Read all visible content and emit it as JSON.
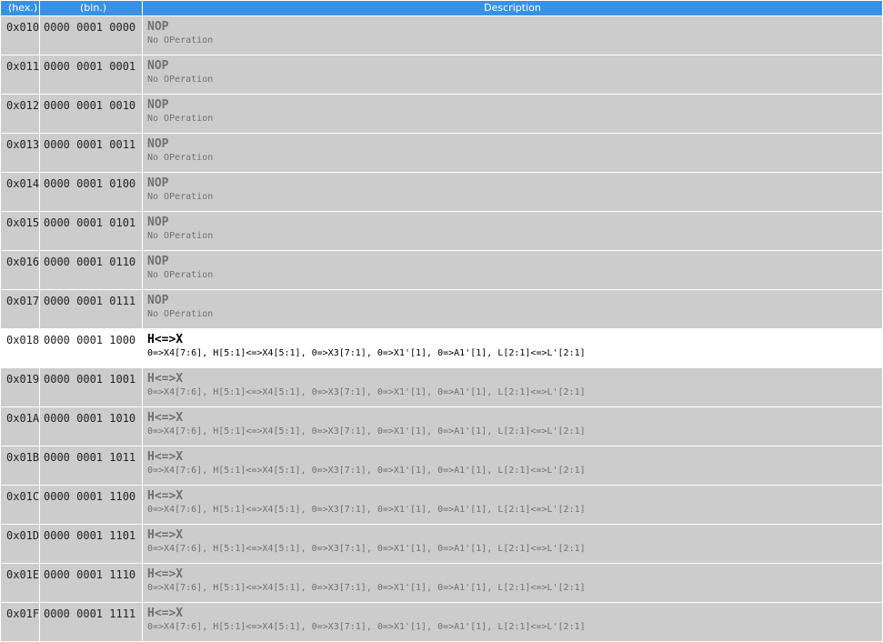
{
  "header": {
    "hex": "(hex.)",
    "bin": "(bin.)",
    "desc": "Description"
  },
  "rows": [
    {
      "hex": "0x010",
      "bin": "0000 0001 0000",
      "mnemonic": "NOP",
      "detail": "No OPeration",
      "active": false
    },
    {
      "hex": "0x011",
      "bin": "0000 0001 0001",
      "mnemonic": "NOP",
      "detail": "No OPeration",
      "active": false
    },
    {
      "hex": "0x012",
      "bin": "0000 0001 0010",
      "mnemonic": "NOP",
      "detail": "No OPeration",
      "active": false
    },
    {
      "hex": "0x013",
      "bin": "0000 0001 0011",
      "mnemonic": "NOP",
      "detail": "No OPeration",
      "active": false
    },
    {
      "hex": "0x014",
      "bin": "0000 0001 0100",
      "mnemonic": "NOP",
      "detail": "No OPeration",
      "active": false
    },
    {
      "hex": "0x015",
      "bin": "0000 0001 0101",
      "mnemonic": "NOP",
      "detail": "No OPeration",
      "active": false
    },
    {
      "hex": "0x016",
      "bin": "0000 0001 0110",
      "mnemonic": "NOP",
      "detail": "No OPeration",
      "active": false
    },
    {
      "hex": "0x017",
      "bin": "0000 0001 0111",
      "mnemonic": "NOP",
      "detail": "No OPeration",
      "active": false
    },
    {
      "hex": "0x018",
      "bin": "0000 0001 1000",
      "mnemonic": "H<=>X",
      "detail": "0=>X4[7:6], H[5:1]<=>X4[5:1], 0=>X3[7:1], 0=>X1'[1], 0=>A1'[1], L[2:1]<=>L'[2:1]",
      "active": true
    },
    {
      "hex": "0x019",
      "bin": "0000 0001 1001",
      "mnemonic": "H<=>X",
      "detail": "0=>X4[7:6], H[5:1]<=>X4[5:1], 0=>X3[7:1], 0=>X1'[1], 0=>A1'[1], L[2:1]<=>L'[2:1]",
      "active": false
    },
    {
      "hex": "0x01A",
      "bin": "0000 0001 1010",
      "mnemonic": "H<=>X",
      "detail": "0=>X4[7:6], H[5:1]<=>X4[5:1], 0=>X3[7:1], 0=>X1'[1], 0=>A1'[1], L[2:1]<=>L'[2:1]",
      "active": false
    },
    {
      "hex": "0x01B",
      "bin": "0000 0001 1011",
      "mnemonic": "H<=>X",
      "detail": "0=>X4[7:6], H[5:1]<=>X4[5:1], 0=>X3[7:1], 0=>X1'[1], 0=>A1'[1], L[2:1]<=>L'[2:1]",
      "active": false
    },
    {
      "hex": "0x01C",
      "bin": "0000 0001 1100",
      "mnemonic": "H<=>X",
      "detail": "0=>X4[7:6], H[5:1]<=>X4[5:1], 0=>X3[7:1], 0=>X1'[1], 0=>A1'[1], L[2:1]<=>L'[2:1]",
      "active": false
    },
    {
      "hex": "0x01D",
      "bin": "0000 0001 1101",
      "mnemonic": "H<=>X",
      "detail": "0=>X4[7:6], H[5:1]<=>X4[5:1], 0=>X3[7:1], 0=>X1'[1], 0=>A1'[1], L[2:1]<=>L'[2:1]",
      "active": false
    },
    {
      "hex": "0x01E",
      "bin": "0000 0001 1110",
      "mnemonic": "H<=>X",
      "detail": "0=>X4[7:6], H[5:1]<=>X4[5:1], 0=>X3[7:1], 0=>X1'[1], 0=>A1'[1], L[2:1]<=>L'[2:1]",
      "active": false
    },
    {
      "hex": "0x01F",
      "bin": "0000 0001 1111",
      "mnemonic": "H<=>X",
      "detail": "0=>X4[7:6], H[5:1]<=>X4[5:1], 0=>X3[7:1], 0=>X1'[1], 0=>A1'[1], L[2:1]<=>L'[2:1]",
      "active": false
    }
  ]
}
